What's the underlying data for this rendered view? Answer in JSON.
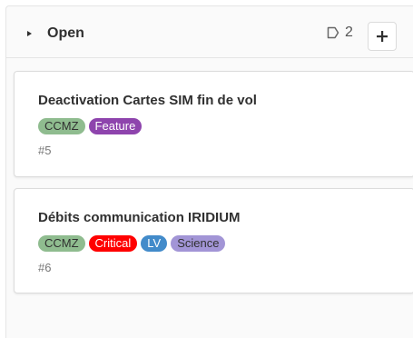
{
  "column": {
    "title": "Open",
    "issue_count": "2",
    "add_button_icon": "plus-icon",
    "collapse_icon": "caret-right-icon",
    "count_icon": "issues-icon"
  },
  "cards": [
    {
      "title": "Deactivation Cartes SIM fin de vol",
      "ref": "#5",
      "labels": [
        {
          "text": "CCMZ",
          "bg": "#8fbc8f",
          "fg": "#303030"
        },
        {
          "text": "Feature",
          "bg": "#8e44ad",
          "fg": "#ffffff"
        }
      ]
    },
    {
      "title": "Débits communication IRIDIUM",
      "ref": "#6",
      "labels": [
        {
          "text": "CCMZ",
          "bg": "#8fbc8f",
          "fg": "#303030"
        },
        {
          "text": "Critical",
          "bg": "#ff0000",
          "fg": "#ffffff"
        },
        {
          "text": "LV",
          "bg": "#428bca",
          "fg": "#ffffff"
        },
        {
          "text": "Science",
          "bg": "#a295d6",
          "fg": "#303030"
        }
      ]
    }
  ],
  "colors": {
    "column_bg": "#fafafa",
    "card_border": "#dcdcdc",
    "text": "#303030"
  }
}
